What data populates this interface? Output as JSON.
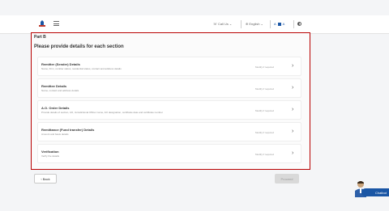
{
  "header": {
    "call_us": "Call Us",
    "language": "English",
    "font_controls": [
      "A",
      "A"
    ],
    "colors": {
      "brand": "#1a56a5"
    }
  },
  "main": {
    "part": "Part B",
    "heading": "Please provide details for each section",
    "cards": [
      {
        "title": "Remitter (Sender) Details",
        "description": "Name, Firm, remitter status, residential status, contact and address details",
        "status": "Modify if required"
      },
      {
        "title": "Remittee Details",
        "description": "Name, contact and address details",
        "status": "Modify if required"
      },
      {
        "title": "A.O. Order Details",
        "description": "Provide details of section, AO, Jurisdictional Officer name, AO designation, certificate date and certificate number",
        "status": "Modify if required"
      },
      {
        "title": "Remittance (Fund transfer) Details",
        "description": "Amount and basis details",
        "status": "Modify if required"
      },
      {
        "title": "Verification",
        "description": "Verify the details",
        "status": "Modify if required"
      }
    ]
  },
  "footer": {
    "back_label": "Back",
    "proceed_label": "Proceed"
  },
  "chatbot": {
    "label": "Chatbot"
  },
  "icons": {
    "logo": "emblem-icon",
    "menu": "hamburger-icon",
    "phone": "phone-icon",
    "globe": "globe-icon",
    "contrast": "contrast-icon",
    "chevron": "chevron-right-icon"
  }
}
